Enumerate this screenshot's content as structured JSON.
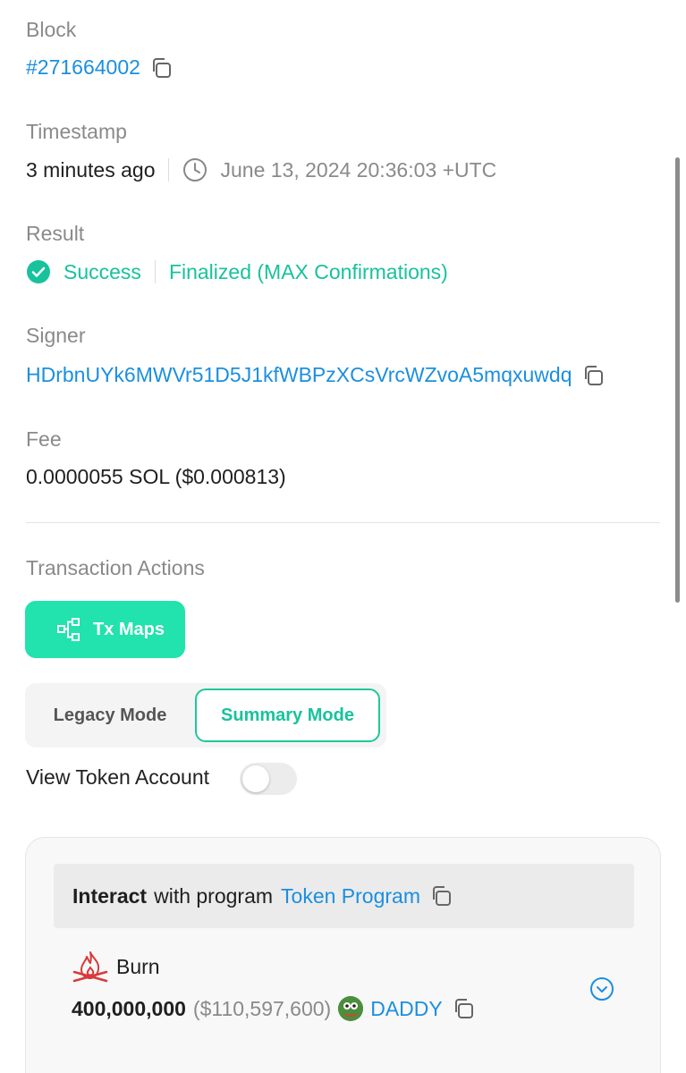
{
  "block": {
    "label": "Block",
    "value": "#271664002"
  },
  "timestamp": {
    "label": "Timestamp",
    "relative": "3 minutes ago",
    "absolute": "June 13, 2024 20:36:03 +UTC"
  },
  "result": {
    "label": "Result",
    "status": "Success",
    "finality": "Finalized (MAX Confirmations)"
  },
  "signer": {
    "label": "Signer",
    "address": "HDrbnUYk6MWVr51D5J1kfWBPzXCsVrcWZvoA5mqxuwdq"
  },
  "fee": {
    "label": "Fee",
    "value": "0.0000055 SOL ($0.000813)"
  },
  "actions": {
    "label": "Transaction Actions",
    "tx_maps_label": "Tx Maps",
    "legacy_mode_label": "Legacy Mode",
    "summary_mode_label": "Summary Mode",
    "view_token_account_label": "View Token Account",
    "view_token_account_enabled": false
  },
  "instruction": {
    "interact_bold": "Interact",
    "interact_text": "with program",
    "program_name": "Token Program",
    "action": "Burn",
    "amount": "400,000,000",
    "usd_value": "($110,597,600)",
    "token_symbol": "DADDY"
  },
  "colors": {
    "accent": "#22e2ad",
    "link": "#1b8fe0",
    "success": "#18c29c"
  }
}
